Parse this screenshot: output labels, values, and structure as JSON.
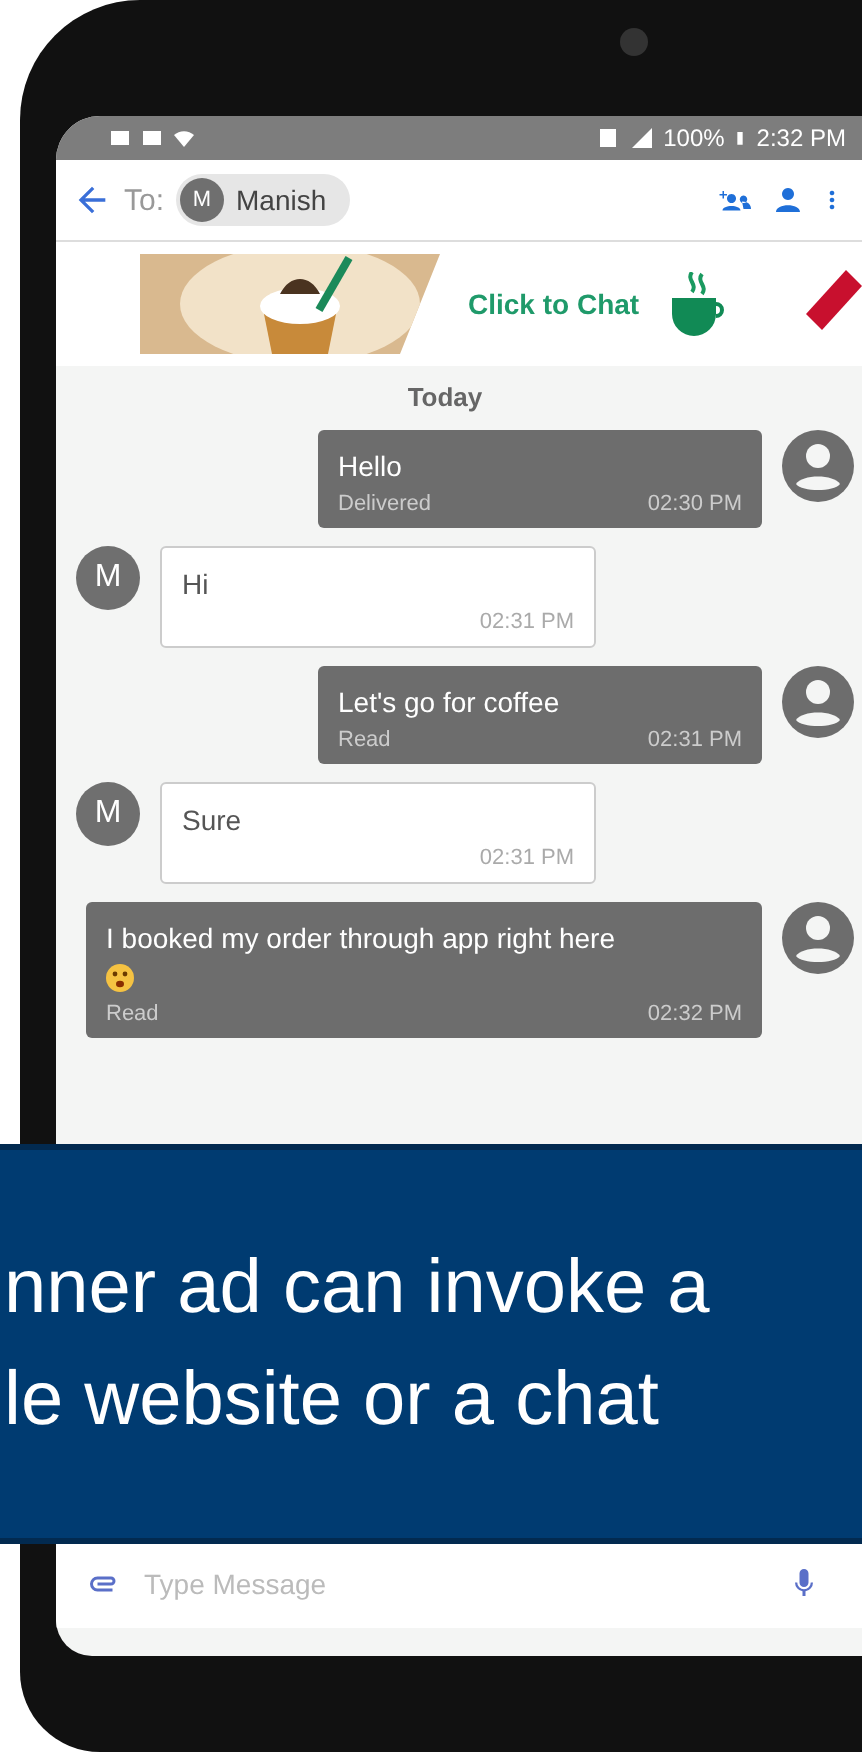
{
  "status_bar": {
    "battery": "100%",
    "time": "2:32 PM"
  },
  "header": {
    "to_label": "To:",
    "recipient": {
      "initial": "M",
      "name": "Manish"
    }
  },
  "banner": {
    "cta": "Click to Chat"
  },
  "date_divider": "Today",
  "messages": [
    {
      "kind": "sent",
      "text": "Hello",
      "status": "Delivered",
      "time": "02:30 PM"
    },
    {
      "kind": "received",
      "avatar": "M",
      "text": "Hi",
      "time": "02:31 PM"
    },
    {
      "kind": "sent",
      "text": "Let's go for coffee",
      "status": "Read",
      "time": "02:31 PM"
    },
    {
      "kind": "received",
      "avatar": "M",
      "text": "Sure",
      "time": "02:31 PM"
    },
    {
      "kind": "sent",
      "text": "I booked my order through app right here",
      "emoji": true,
      "status": "Read",
      "time": "02:32 PM"
    }
  ],
  "composer": {
    "placeholder": "Type Message"
  },
  "caption": {
    "lines": [
      "nner ad can invoke a",
      "le website or a chat"
    ]
  }
}
